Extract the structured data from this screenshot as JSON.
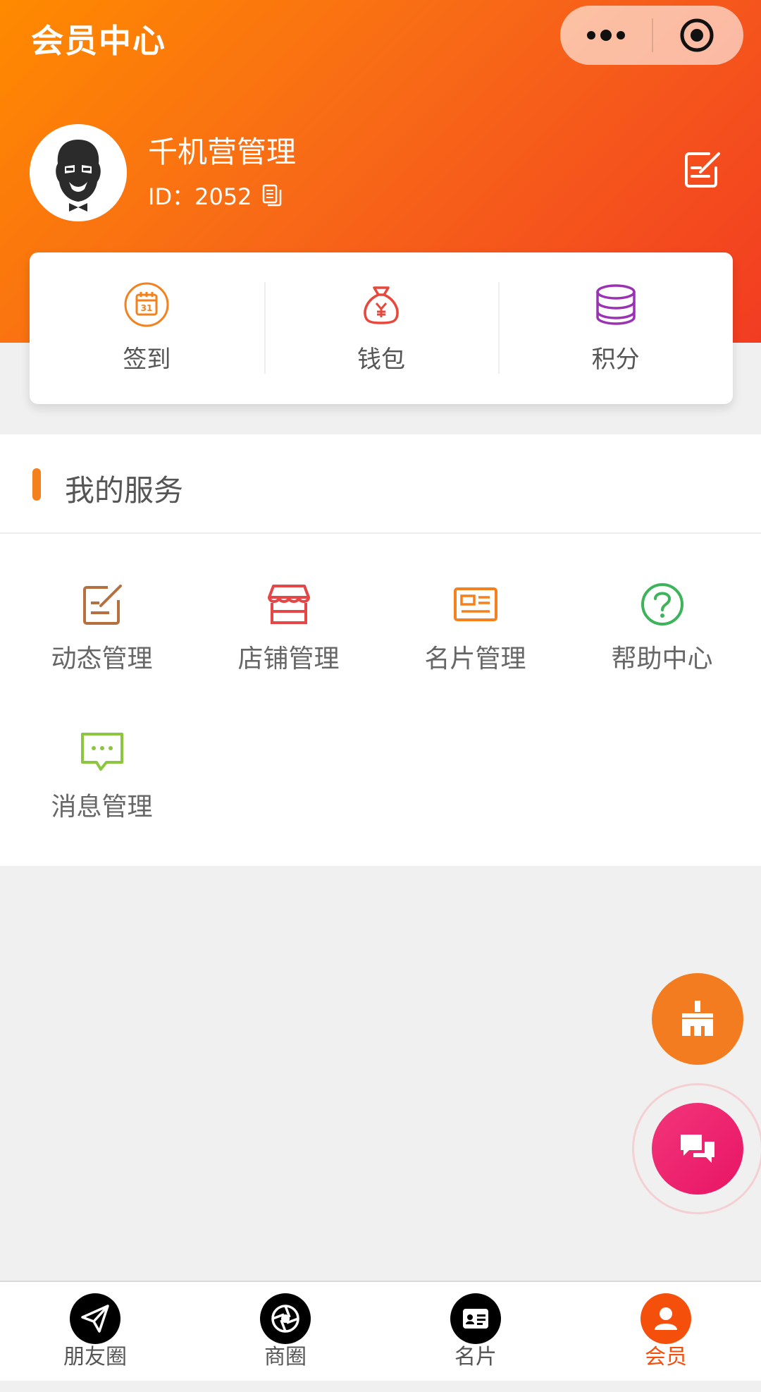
{
  "header": {
    "title": "会员中心",
    "capsule": {
      "more_icon": "more-dots-icon",
      "target_icon": "target-circle-icon"
    }
  },
  "profile": {
    "name": "千机营管理",
    "id_text": "ID：2052",
    "avatar_icon": "gorilla-avatar",
    "edit_icon": "edit-note-icon",
    "copy_icon": "copy-icon"
  },
  "quick_actions": [
    {
      "label": "签到",
      "icon": "calendar-icon",
      "color": "#f4801e"
    },
    {
      "label": "钱包",
      "icon": "money-bag-icon",
      "color": "#e8473c"
    },
    {
      "label": "积分",
      "icon": "coin-stack-icon",
      "color": "#9b32b4"
    }
  ],
  "services": {
    "title": "我的服务",
    "accent": "#f4801e",
    "items": [
      {
        "label": "动态管理",
        "icon": "edit-note-icon",
        "color": "#b5703f"
      },
      {
        "label": "店铺管理",
        "icon": "store-icon",
        "color": "#e54646"
      },
      {
        "label": "名片管理",
        "icon": "id-card-icon",
        "color": "#f4801e"
      },
      {
        "label": "帮助中心",
        "icon": "help-circle-icon",
        "color": "#3db35a"
      },
      {
        "label": "消息管理",
        "icon": "message-icon",
        "color": "#8cc63f"
      }
    ]
  },
  "floating": {
    "sweep_icon": "broom-icon",
    "chat_icon": "chat-bubbles-icon"
  },
  "tabbar": {
    "items": [
      {
        "label": "朋友圈",
        "icon": "paper-plane-icon",
        "active": false
      },
      {
        "label": "商圈",
        "icon": "aperture-icon",
        "active": false
      },
      {
        "label": "名片",
        "icon": "card-icon",
        "active": false
      },
      {
        "label": "会员",
        "icon": "user-icon",
        "active": true
      }
    ],
    "active_color": "#f4500c"
  }
}
